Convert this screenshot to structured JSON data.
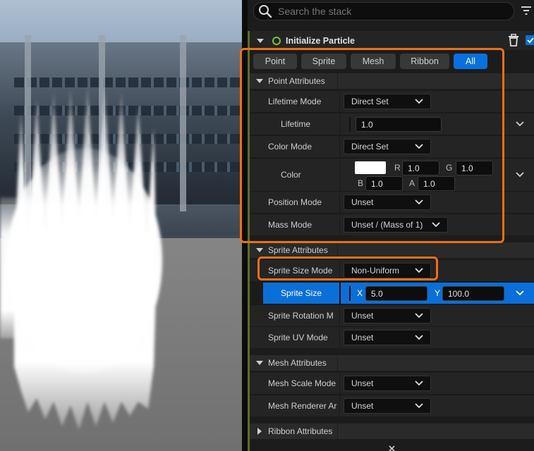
{
  "search": {
    "placeholder": "Search the stack"
  },
  "module": {
    "title": "Initialize Particle"
  },
  "tabs": [
    "Point",
    "Sprite",
    "Mesh",
    "Ribbon",
    "All"
  ],
  "active_tab": "All",
  "point_attributes": {
    "header": "Point Attributes",
    "lifetime_mode_label": "Lifetime Mode",
    "lifetime_mode_value": "Direct Set",
    "lifetime_label": "Lifetime",
    "lifetime_value": "1.0",
    "color_mode_label": "Color Mode",
    "color_mode_value": "Direct Set",
    "color_label": "Color",
    "color_r_label": "R",
    "color_r": "1.0",
    "color_g_label": "G",
    "color_g": "1.0",
    "color_b_label": "B",
    "color_b": "1.0",
    "color_a_label": "A",
    "color_a": "1.0",
    "color_swatch": "#ffffff",
    "position_mode_label": "Position Mode",
    "position_mode_value": "Unset",
    "mass_mode_label": "Mass Mode",
    "mass_mode_value": "Unset / (Mass of 1)"
  },
  "sprite_attributes": {
    "header": "Sprite Attributes",
    "size_mode_label": "Sprite Size Mode",
    "size_mode_value": "Non-Uniform",
    "size_label": "Sprite Size",
    "size_x_label": "X",
    "size_x": "5.0",
    "size_y_label": "Y",
    "size_y": "100.0",
    "rotation_mode_label": "Sprite Rotation M",
    "rotation_mode_value": "Unset",
    "uv_mode_label": "Sprite UV Mode",
    "uv_mode_value": "Unset"
  },
  "mesh_attributes": {
    "header": "Mesh Attributes",
    "scale_mode_label": "Mesh Scale Mode",
    "scale_mode_value": "Unset",
    "renderer_label": "Mesh Renderer Ar",
    "renderer_value": "Unset"
  },
  "ribbon_attributes": {
    "header": "Ribbon Attributes"
  },
  "colors": {
    "accent_blue": "#0a70e0",
    "highlight_orange": "#f07010",
    "module_green": "#5b6d2c"
  }
}
